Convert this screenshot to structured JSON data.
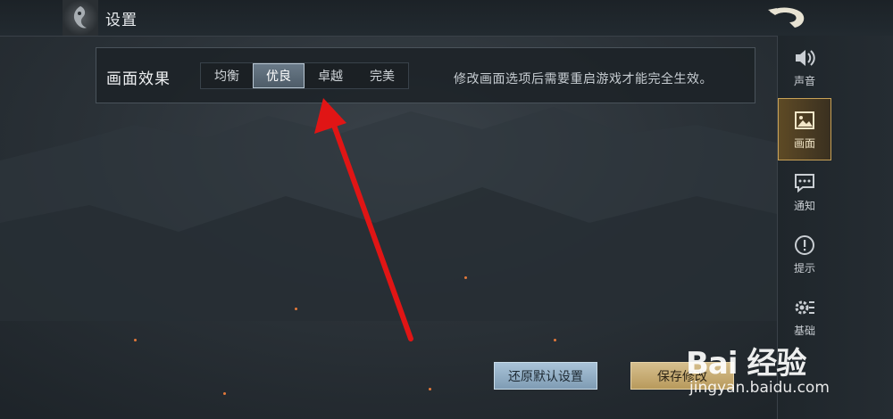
{
  "header": {
    "title": "设置"
  },
  "panel": {
    "label": "画面效果",
    "options": [
      "均衡",
      "优良",
      "卓越",
      "完美"
    ],
    "selected": "优良",
    "hint": "修改画面选项后需要重启游戏才能完全生效。"
  },
  "sidebar": {
    "items": [
      {
        "label": "声音",
        "icon": "speaker-icon"
      },
      {
        "label": "画面",
        "icon": "image-icon",
        "active": true
      },
      {
        "label": "通知",
        "icon": "chat-icon"
      },
      {
        "label": "提示",
        "icon": "alert-icon"
      },
      {
        "label": "基础",
        "icon": "gear-icon"
      }
    ]
  },
  "buttons": {
    "restore": "还原默认设置",
    "save": "保存修改"
  },
  "watermark": {
    "brand": "Bai 经验",
    "url": "jingyan.baidu.com"
  },
  "colors": {
    "accent_gold": "#c9a257",
    "annotation_arrow": "#e01515"
  }
}
